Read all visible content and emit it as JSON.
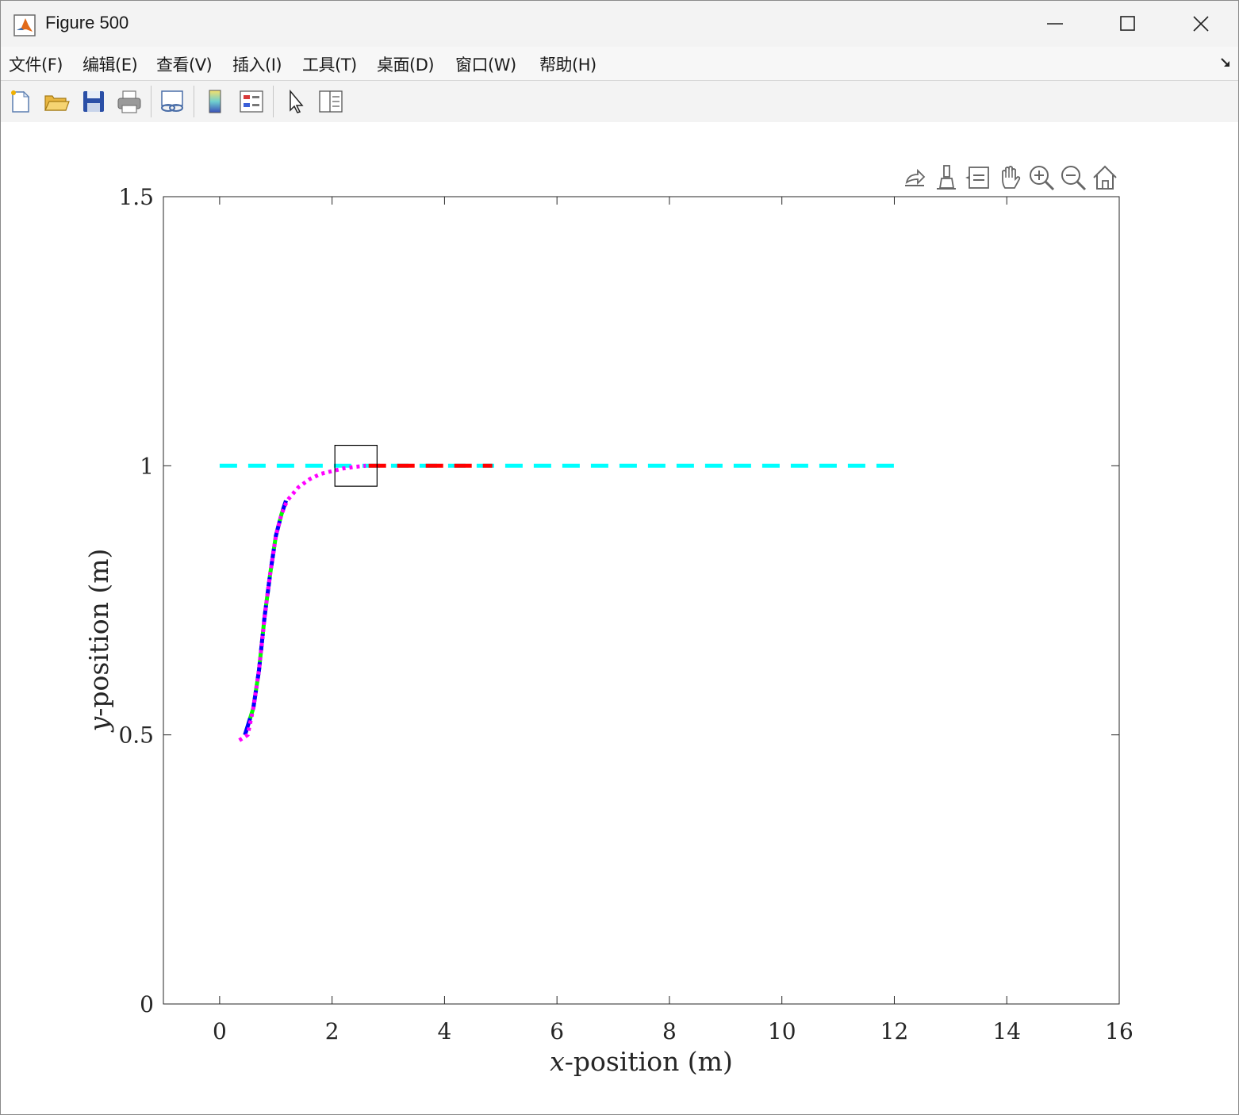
{
  "window": {
    "title": "Figure 500"
  },
  "menu": {
    "items": [
      "文件(F)",
      "编辑(E)",
      "查看(V)",
      "插入(I)",
      "工具(T)",
      "桌面(D)",
      "窗口(W)",
      "帮助(H)"
    ]
  },
  "toolbar": {
    "icons": [
      "new-figure-icon",
      "open-file-icon",
      "save-icon",
      "print-icon",
      "link-plot-icon",
      "colorbar-icon",
      "legend-icon",
      "edit-plot-arrow-icon",
      "property-inspector-icon"
    ]
  },
  "axes_toolbar": {
    "icons": [
      "export-icon",
      "brush-icon",
      "data-tips-icon",
      "pan-hand-icon",
      "zoom-in-icon",
      "zoom-out-icon",
      "home-icon"
    ]
  },
  "chart_data": {
    "type": "line",
    "title": "",
    "xlabel_var": "x",
    "xlabel_rest": "-position (m)",
    "ylabel_var": "y",
    "ylabel_rest": "-position (m)",
    "xlim": [
      -1,
      16
    ],
    "ylim": [
      0,
      1.5
    ],
    "xticks": [
      "0",
      "2",
      "4",
      "6",
      "8",
      "10",
      "12",
      "14",
      "16"
    ],
    "yticks": [
      "0",
      "0.5",
      "1",
      "1.5"
    ],
    "grid": false,
    "legend": "none",
    "series": [
      {
        "color": "#00ffff",
        "style": "dashed",
        "x": [
          0,
          12
        ],
        "y": [
          1.0,
          1.0
        ]
      },
      {
        "color": "#ff0000",
        "style": "dashed",
        "x": [
          2.65,
          4.85
        ],
        "y": [
          1.0,
          1.0
        ]
      },
      {
        "color": "#00ff00",
        "style": "solid",
        "x": [
          0.45,
          0.6,
          0.7,
          0.8,
          0.9,
          1.0,
          1.1,
          1.18
        ],
        "y": [
          0.5,
          0.55,
          0.62,
          0.72,
          0.8,
          0.87,
          0.91,
          0.935
        ]
      },
      {
        "color": "#0000ff",
        "style": "dashed",
        "x": [
          0.45,
          0.6,
          0.7,
          0.8,
          0.9,
          1.0,
          1.1,
          1.18
        ],
        "y": [
          0.5,
          0.55,
          0.62,
          0.72,
          0.8,
          0.87,
          0.91,
          0.935
        ]
      },
      {
        "color": "#ff00ff",
        "style": "dotted",
        "x": [
          0.35,
          0.5,
          0.6,
          0.7,
          0.8,
          0.9,
          1.0,
          1.1,
          1.2,
          1.4,
          1.6,
          1.8,
          2.0,
          2.2,
          2.4,
          2.6
        ],
        "y": [
          0.49,
          0.5,
          0.55,
          0.62,
          0.72,
          0.8,
          0.87,
          0.91,
          0.935,
          0.96,
          0.975,
          0.985,
          0.99,
          0.995,
          0.998,
          1.0
        ]
      }
    ],
    "marker_box": {
      "x": [
        2.05,
        2.8
      ],
      "y": [
        0.962,
        1.038
      ]
    }
  }
}
